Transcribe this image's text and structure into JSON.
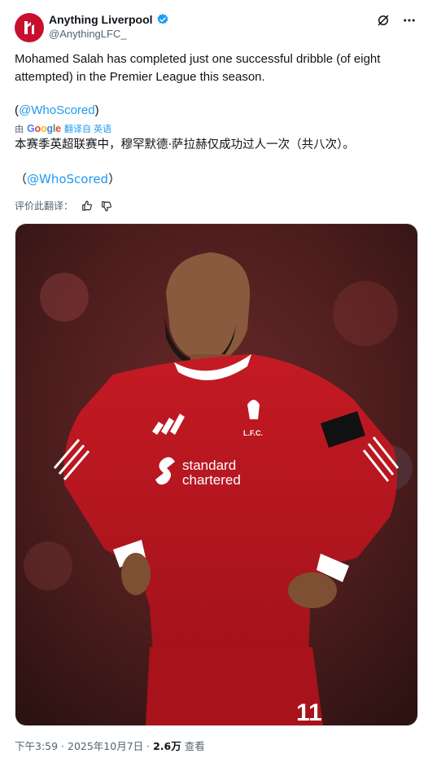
{
  "account": {
    "display_name": "Anything Liverpool",
    "handle": "@AnythingLFC_"
  },
  "tweet": {
    "text": "Mohamed Salah has completed just one successful dribble (of eight attempted) in the Premier League this season.",
    "mention_open": "(",
    "mention": "@WhoScored",
    "mention_close": ")"
  },
  "translation": {
    "by": "由",
    "provider": "Google",
    "link": "翻译自 英语",
    "text": "本赛季英超联赛中，穆罕默德·萨拉赫仅成功过人一次（共八次）。",
    "mention_open": "（",
    "mention": "@WhoScored",
    "mention_close": "）",
    "rate_label": "评价此翻译："
  },
  "media": {
    "sponsor_line1": "standard",
    "sponsor_line2": "chartered",
    "crest_text": "L.F.C.",
    "shirt_number": "11"
  },
  "meta": {
    "time": "下午3:59",
    "separator1": " · ",
    "date": "2025年10月7日",
    "separator2": " · ",
    "views": "2.6万",
    "views_label": " 查看"
  },
  "colors": {
    "brand_red": "#c8102e",
    "link_blue": "#1d9bf0",
    "text": "#0f1419",
    "muted": "#536471"
  },
  "icons": [
    "lfc-logo-icon",
    "verified-badge-icon",
    "grok-icon",
    "more-icon",
    "thumbs-up-icon",
    "thumbs-down-icon"
  ]
}
